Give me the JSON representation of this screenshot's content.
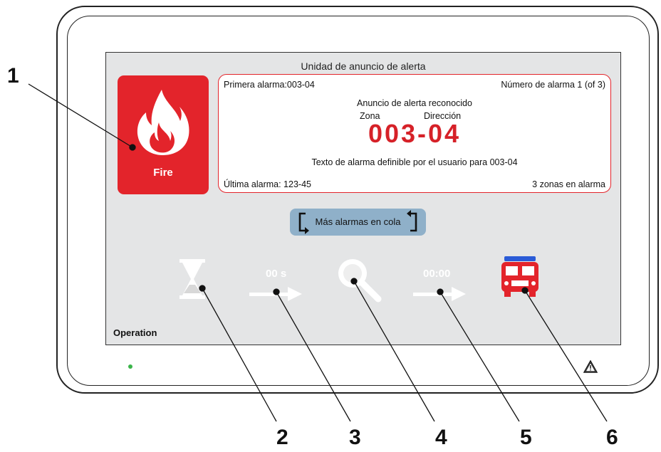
{
  "screen": {
    "title": "Unidad de anuncio de alerta",
    "fire_tile": {
      "icon": "flame-icon",
      "label": "Fire",
      "color": "#e3242b"
    },
    "alarm_panel": {
      "first_alarm": "Primera alarma:003-04",
      "alarm_number": "Número de alarma 1 (of 3)",
      "status": "Anuncio de alerta reconocido",
      "zone_label": "Zona",
      "address_label": "Dirección",
      "code": "003-04",
      "user_text": "Texto de alarma definible por el usuario para 003-04",
      "last_alarm": "Última alarma: 123-45",
      "zones_in_alarm": "3 zonas en alarma"
    },
    "queue_button": {
      "label": "Más alarmas en cola",
      "icon": "cycle-arrows-icon"
    },
    "steps": {
      "delay_time": "00 s",
      "investigation_time": "00:00"
    },
    "mode_label": "Operation"
  },
  "callouts": [
    "1",
    "2",
    "3",
    "4",
    "5",
    "6"
  ],
  "colors": {
    "alarm_red": "#e3242b",
    "screen_bg": "#e4e5e6",
    "button_blue": "#8fb0c9",
    "led_green": "#3bb44a",
    "dimmed_icon": "#ffffff"
  }
}
